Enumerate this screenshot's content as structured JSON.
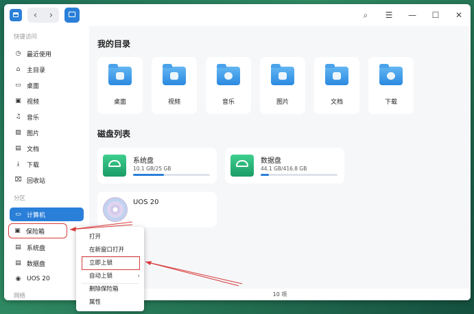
{
  "titlebar": {
    "back_icon": "‹",
    "forward_icon": "›",
    "search_icon": "⌕",
    "menu_icon": "☰",
    "min_icon": "—",
    "max_icon": "☐",
    "close_icon": "✕"
  },
  "sidebar": {
    "quick_access_header": "快捷访问",
    "quick_items": [
      {
        "label": "最近使用",
        "icon": "◷"
      },
      {
        "label": "主目录",
        "icon": "⌂"
      },
      {
        "label": "桌面",
        "icon": "▭"
      },
      {
        "label": "视频",
        "icon": "▣"
      },
      {
        "label": "音乐",
        "icon": "♫"
      },
      {
        "label": "图片",
        "icon": "▨"
      },
      {
        "label": "文档",
        "icon": "▤"
      },
      {
        "label": "下载",
        "icon": "⤓"
      },
      {
        "label": "回收站",
        "icon": "⌧"
      }
    ],
    "partition_header": "分区",
    "partition_items": [
      {
        "label": "计算机",
        "icon": "▭"
      },
      {
        "label": "保险箱",
        "icon": "▣"
      },
      {
        "label": "系统盘",
        "icon": "▤"
      },
      {
        "label": "数据盘",
        "icon": "▤"
      },
      {
        "label": "UOS 20",
        "icon": "◉"
      }
    ],
    "network_header": "网络"
  },
  "main": {
    "my_dirs_title": "我的目录",
    "dirs": [
      {
        "label": "桌面"
      },
      {
        "label": "视频"
      },
      {
        "label": "音乐"
      },
      {
        "label": "图片"
      },
      {
        "label": "文档"
      },
      {
        "label": "下载"
      }
    ],
    "disks_title": "磁盘列表",
    "disks": [
      {
        "name": "系统盘",
        "size": "10.1 GB/25 GB",
        "usage": 0.4
      },
      {
        "name": "数据盘",
        "size": "44.1 GB/416.8 GB",
        "usage": 0.11
      }
    ],
    "disc": {
      "name": "UOS 20"
    }
  },
  "status": {
    "count": "10 项"
  },
  "context_menu": {
    "items": [
      "打开",
      "在新窗口打开",
      "立即上锁",
      "自动上锁",
      "删除保险箱",
      "属性"
    ],
    "submenu_arrow": "›"
  },
  "colors": {
    "accent": "#2a7fd9",
    "annotation": "#d93a3a"
  }
}
